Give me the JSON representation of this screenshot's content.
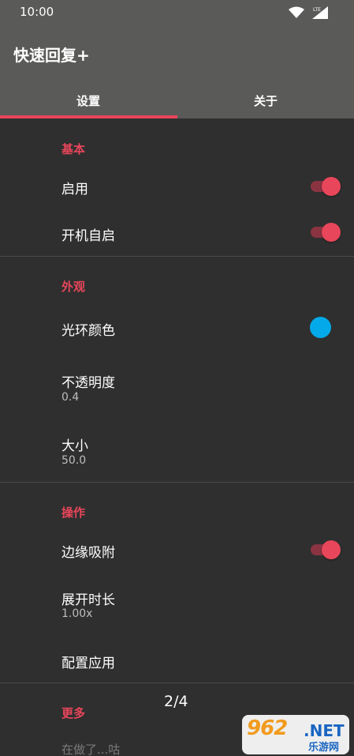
{
  "status_bar": {
    "time": "10:00",
    "network_label": "LTE"
  },
  "app_bar": {
    "title": "快速回复+"
  },
  "tabs": [
    {
      "label": "设置",
      "selected": true
    },
    {
      "label": "关于",
      "selected": false
    }
  ],
  "sections": {
    "basic": {
      "header": "基本",
      "enable": {
        "title": "启用",
        "on": true
      },
      "boot_start": {
        "title": "开机自启",
        "on": true
      }
    },
    "appearance": {
      "header": "外观",
      "ring_color": {
        "title": "光环颜色",
        "color": "#03a9e8"
      },
      "opacity": {
        "title": "不透明度",
        "summary": "0.4"
      },
      "size": {
        "title": "大小",
        "summary": "50.0"
      }
    },
    "operation": {
      "header": "操作",
      "edge_snap": {
        "title": "边缘吸附",
        "on": true
      },
      "expand_duration": {
        "title": "展开时长",
        "summary": "1.00x"
      },
      "configure_apps": {
        "title": "配置应用"
      }
    },
    "more": {
      "header": "更多",
      "todo": {
        "title": "在做了...咕"
      }
    }
  },
  "page_indicator": "2/4",
  "watermark": {
    "main": "962",
    "net": ".NET",
    "sub": "乐游网"
  },
  "colors": {
    "accent": "#e8465a",
    "app_bar": "#5a5a58",
    "background": "#2f2f2f"
  }
}
